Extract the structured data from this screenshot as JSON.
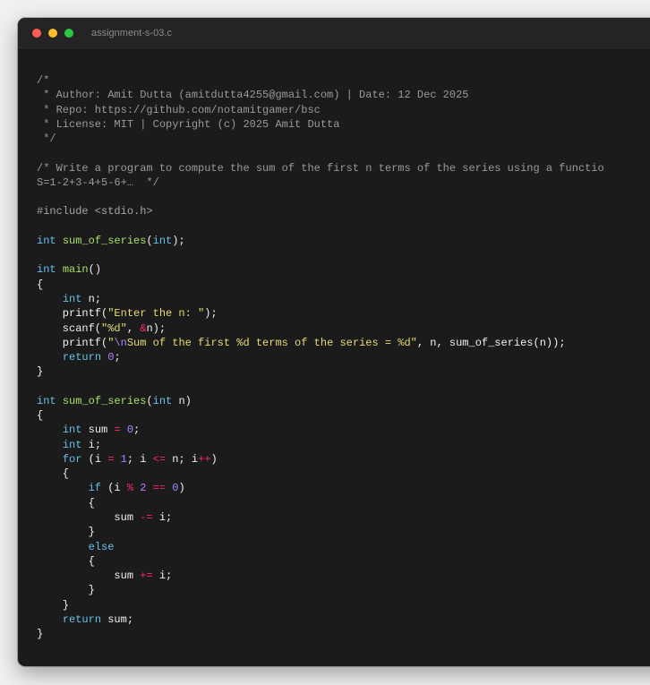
{
  "window": {
    "title": "assignment-s-03.c",
    "controls": [
      "close",
      "minimize",
      "maximize"
    ]
  },
  "colors": {
    "background": "#1b1b1b",
    "titlebar": "#242424",
    "comment": "#9a9a9a",
    "keyword": "#66c2e8",
    "function": "#a7e06a",
    "string": "#e7db74",
    "number": "#ae81ff",
    "operator": "#f92672",
    "plain": "#f2f2f2",
    "close_dot": "#ff5f57",
    "minimize_dot": "#febc2e",
    "maximize_dot": "#28c840"
  },
  "code_lines": [
    [
      {
        "t": "cm",
        "v": "/*"
      }
    ],
    [
      {
        "t": "cm",
        "v": " * Author: Amit Dutta (amitdutta4255@gmail.com) | Date: 12 Dec 2025"
      }
    ],
    [
      {
        "t": "cm",
        "v": " * Repo: https://github.com/notamitgamer/bsc"
      }
    ],
    [
      {
        "t": "cm",
        "v": " * License: MIT | Copyright (c) 2025 Amit Dutta"
      }
    ],
    [
      {
        "t": "cm",
        "v": " */"
      }
    ],
    [],
    [
      {
        "t": "cm",
        "v": "/* Write a program to compute the sum of the first n terms of the series using a functio"
      }
    ],
    [
      {
        "t": "cm",
        "v": "S=1-2+3-4+5-6+…  */"
      }
    ],
    [],
    [
      {
        "t": "pp",
        "v": "#include <stdio.h>"
      }
    ],
    [],
    [
      {
        "t": "kw",
        "v": "int"
      },
      {
        "t": "pl",
        "v": " "
      },
      {
        "t": "fn",
        "v": "sum_of_series"
      },
      {
        "t": "pl",
        "v": "("
      },
      {
        "t": "kw",
        "v": "int"
      },
      {
        "t": "pl",
        "v": ");"
      }
    ],
    [],
    [
      {
        "t": "kw",
        "v": "int"
      },
      {
        "t": "pl",
        "v": " "
      },
      {
        "t": "fn",
        "v": "main"
      },
      {
        "t": "pl",
        "v": "()"
      }
    ],
    [
      {
        "t": "pl",
        "v": "{"
      }
    ],
    [
      {
        "t": "pl",
        "v": "    "
      },
      {
        "t": "kw",
        "v": "int"
      },
      {
        "t": "pl",
        "v": " n;"
      }
    ],
    [
      {
        "t": "pl",
        "v": "    printf("
      },
      {
        "t": "str",
        "v": "\"Enter the n: \""
      },
      {
        "t": "pl",
        "v": ");"
      }
    ],
    [
      {
        "t": "pl",
        "v": "    scanf("
      },
      {
        "t": "str",
        "v": "\"%d\""
      },
      {
        "t": "pl",
        "v": ", "
      },
      {
        "t": "op",
        "v": "&"
      },
      {
        "t": "pl",
        "v": "n);"
      }
    ],
    [
      {
        "t": "pl",
        "v": "    printf("
      },
      {
        "t": "str",
        "v": "\""
      },
      {
        "t": "esc",
        "v": "\\n"
      },
      {
        "t": "str",
        "v": "Sum of the first %d terms of the series = %d\""
      },
      {
        "t": "pl",
        "v": ", n, sum_of_series(n));"
      }
    ],
    [
      {
        "t": "pl",
        "v": "    "
      },
      {
        "t": "kw",
        "v": "return"
      },
      {
        "t": "pl",
        "v": " "
      },
      {
        "t": "num",
        "v": "0"
      },
      {
        "t": "pl",
        "v": ";"
      }
    ],
    [
      {
        "t": "pl",
        "v": "}"
      }
    ],
    [],
    [
      {
        "t": "kw",
        "v": "int"
      },
      {
        "t": "pl",
        "v": " "
      },
      {
        "t": "fn",
        "v": "sum_of_series"
      },
      {
        "t": "pl",
        "v": "("
      },
      {
        "t": "kw",
        "v": "int"
      },
      {
        "t": "pl",
        "v": " n)"
      }
    ],
    [
      {
        "t": "pl",
        "v": "{"
      }
    ],
    [
      {
        "t": "pl",
        "v": "    "
      },
      {
        "t": "kw",
        "v": "int"
      },
      {
        "t": "pl",
        "v": " sum "
      },
      {
        "t": "op",
        "v": "="
      },
      {
        "t": "pl",
        "v": " "
      },
      {
        "t": "num",
        "v": "0"
      },
      {
        "t": "pl",
        "v": ";"
      }
    ],
    [
      {
        "t": "pl",
        "v": "    "
      },
      {
        "t": "kw",
        "v": "int"
      },
      {
        "t": "pl",
        "v": " i;"
      }
    ],
    [
      {
        "t": "pl",
        "v": "    "
      },
      {
        "t": "kw",
        "v": "for"
      },
      {
        "t": "pl",
        "v": " (i "
      },
      {
        "t": "op",
        "v": "="
      },
      {
        "t": "pl",
        "v": " "
      },
      {
        "t": "num",
        "v": "1"
      },
      {
        "t": "pl",
        "v": "; i "
      },
      {
        "t": "op",
        "v": "<="
      },
      {
        "t": "pl",
        "v": " n; i"
      },
      {
        "t": "op",
        "v": "++"
      },
      {
        "t": "pl",
        "v": ")"
      }
    ],
    [
      {
        "t": "pl",
        "v": "    {"
      }
    ],
    [
      {
        "t": "pl",
        "v": "        "
      },
      {
        "t": "kw",
        "v": "if"
      },
      {
        "t": "pl",
        "v": " (i "
      },
      {
        "t": "op",
        "v": "%"
      },
      {
        "t": "pl",
        "v": " "
      },
      {
        "t": "num",
        "v": "2"
      },
      {
        "t": "pl",
        "v": " "
      },
      {
        "t": "op",
        "v": "=="
      },
      {
        "t": "pl",
        "v": " "
      },
      {
        "t": "num",
        "v": "0"
      },
      {
        "t": "pl",
        "v": ")"
      }
    ],
    [
      {
        "t": "pl",
        "v": "        {"
      }
    ],
    [
      {
        "t": "pl",
        "v": "            sum "
      },
      {
        "t": "op",
        "v": "-="
      },
      {
        "t": "pl",
        "v": " i;"
      }
    ],
    [
      {
        "t": "pl",
        "v": "        }"
      }
    ],
    [
      {
        "t": "pl",
        "v": "        "
      },
      {
        "t": "kw",
        "v": "else"
      }
    ],
    [
      {
        "t": "pl",
        "v": "        {"
      }
    ],
    [
      {
        "t": "pl",
        "v": "            sum "
      },
      {
        "t": "op",
        "v": "+="
      },
      {
        "t": "pl",
        "v": " i;"
      }
    ],
    [
      {
        "t": "pl",
        "v": "        }"
      }
    ],
    [
      {
        "t": "pl",
        "v": "    }"
      }
    ],
    [
      {
        "t": "pl",
        "v": "    "
      },
      {
        "t": "kw",
        "v": "return"
      },
      {
        "t": "pl",
        "v": " sum;"
      }
    ],
    [
      {
        "t": "pl",
        "v": "}"
      }
    ]
  ]
}
